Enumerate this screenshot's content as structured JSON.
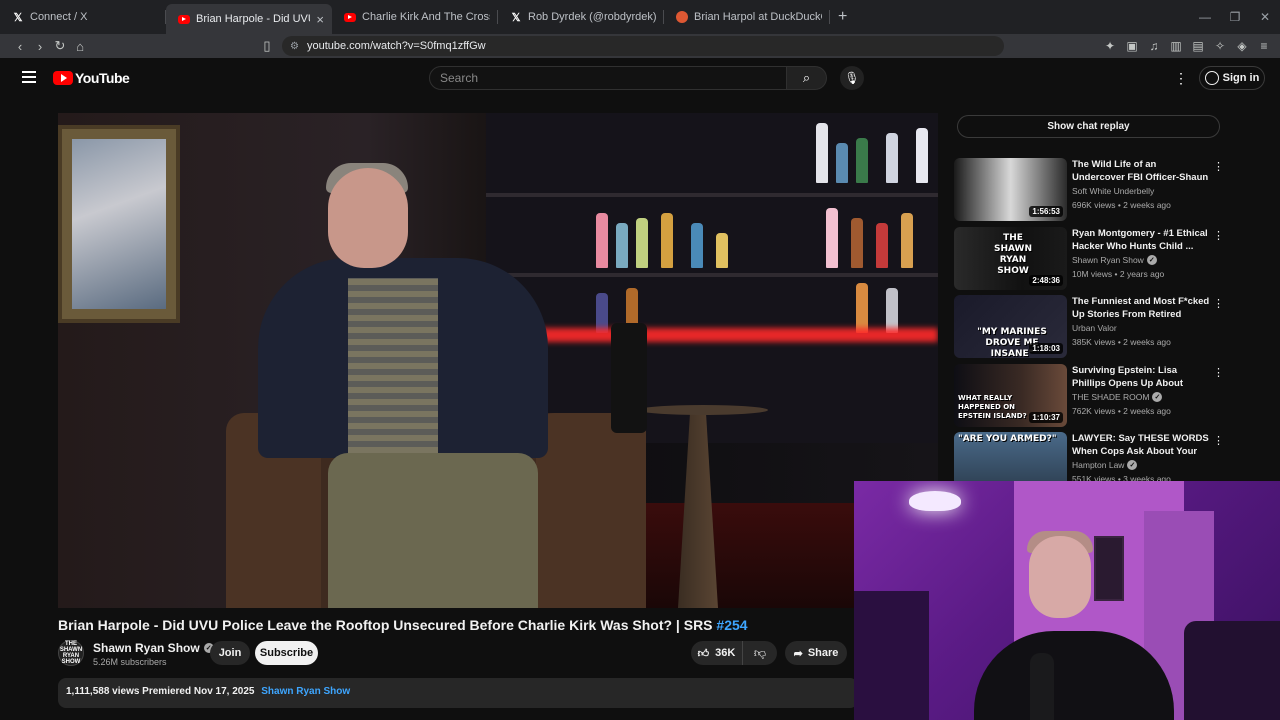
{
  "browser": {
    "tabs": [
      {
        "title": "Connect / X",
        "favicon": "x-icon",
        "active": false
      },
      {
        "title": "Brian Harpole - Did UVU Police L",
        "favicon": "youtube-icon",
        "active": true
      },
      {
        "title": "Charlie Kirk And The Crossing Of The",
        "favicon": "youtube-icon",
        "active": false
      },
      {
        "title": "Rob Dyrdek (@robdyrdek) / X",
        "favicon": "x-icon",
        "active": false
      },
      {
        "title": "Brian Harpol at DuckDuckGo",
        "favicon": "duckduckgo-icon",
        "active": false
      }
    ],
    "url": "youtube.com/watch?v=S0fmq1zffGw"
  },
  "youtube": {
    "logo_text": "YouTube",
    "search_placeholder": "Search",
    "signin_label": "Sign in"
  },
  "video": {
    "title": "Brian Harpole - Did UVU Police Leave the Rooftop Unsecured Before Charlie Kirk Was Shot? | SRS",
    "hashtag": "#254",
    "channel": "Shawn Ryan Show",
    "avatar_text": "THE SHAWN RYAN SHOW",
    "subscribers": "5.26M subscribers",
    "join_label": "Join",
    "subscribe_label": "Subscribe",
    "likes": "36K",
    "share_label": "Share",
    "description_stats": "1,111,588 views  Premiered Nov 17, 2025",
    "description_tag": "Shawn Ryan Show"
  },
  "sidebar": {
    "chat_replay_label": "Show chat replay",
    "recommendations": [
      {
        "title": "The Wild Life of an Undercover FBI Officer-Shaun \"Dutch\" ...",
        "channel": "Soft White Underbelly",
        "verified": false,
        "meta": "696K views • 2 weeks ago",
        "duration": "1:56:53",
        "thumb_text": ""
      },
      {
        "title": "Ryan Montgomery - #1 Ethical Hacker Who Hunts Child ...",
        "channel": "Shawn Ryan Show",
        "verified": true,
        "meta": "10M views • 2 years ago",
        "duration": "2:48:36",
        "thumb_text": "THE SHAWN RYAN SHOW"
      },
      {
        "title": "The Funniest and Most F*cked Up Stories From Retired Marin...",
        "channel": "Urban Valor",
        "verified": false,
        "meta": "385K views • 2 weeks ago",
        "duration": "1:18:03",
        "thumb_text": "\"MY MARINES DROVE ME INSANE\""
      },
      {
        "title": "Surviving Epstein: Lisa Phillips Opens Up About Grooming, ...",
        "channel": "THE SHADE ROOM",
        "verified": true,
        "meta": "762K views • 2 weeks ago",
        "duration": "1:10:37",
        "thumb_text": "WHAT REALLY HAPPENED ON EPSTEIN ISLAND?"
      },
      {
        "title": "LAWYER: Say THESE WORDS When Cops Ask About Your Gun",
        "channel": "Hampton Law",
        "verified": true,
        "meta": "551K views • 3 weeks ago",
        "duration": "",
        "thumb_text": "\"ARE YOU ARMED?\""
      }
    ]
  },
  "colors": {
    "yt_red": "#ff0000",
    "link_blue": "#3ea6ff",
    "bg": "#0f0f0f"
  }
}
